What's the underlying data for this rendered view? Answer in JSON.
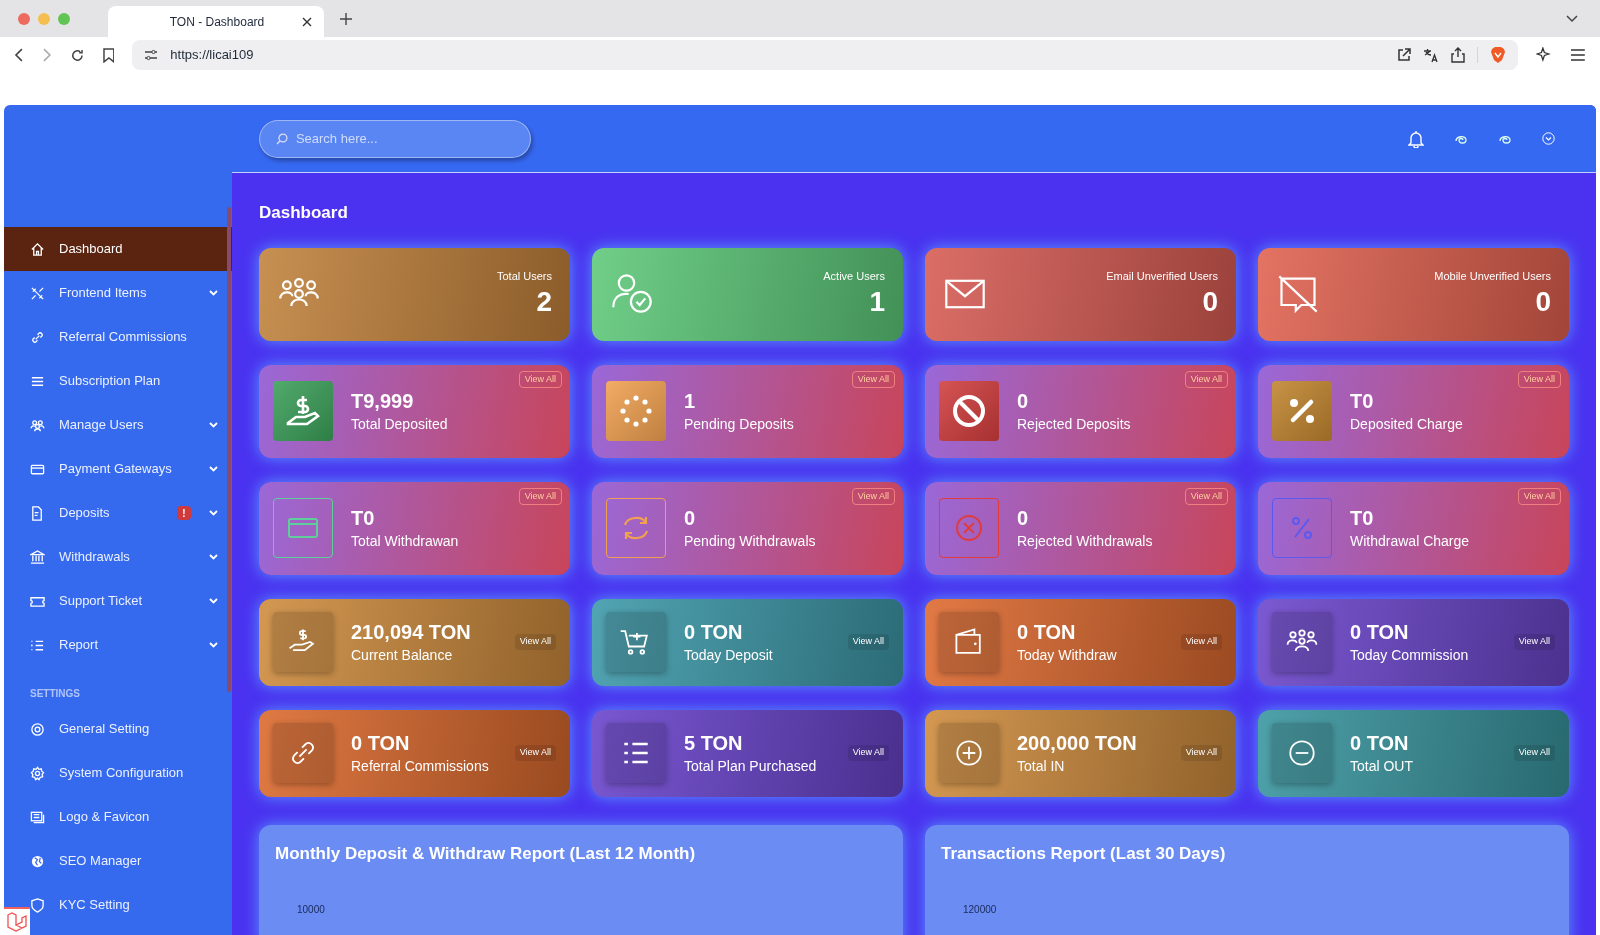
{
  "browser": {
    "tab_title": "TON - Dashboard",
    "url": "https://licai109"
  },
  "header": {
    "search": {
      "placeholder": "Search here..."
    }
  },
  "sidebar": {
    "items": [
      {
        "label": "Dashboard",
        "selected": true,
        "expandable": false
      },
      {
        "label": "Frontend Items",
        "selected": false,
        "expandable": true
      },
      {
        "label": "Referral Commissions",
        "selected": false,
        "expandable": false
      },
      {
        "label": "Subscription Plan",
        "selected": false,
        "expandable": false
      },
      {
        "label": "Manage Users",
        "selected": false,
        "expandable": true
      },
      {
        "label": "Payment Gateways",
        "selected": false,
        "expandable": true
      },
      {
        "label": "Deposits",
        "selected": false,
        "expandable": true,
        "badge": "!"
      },
      {
        "label": "Withdrawals",
        "selected": false,
        "expandable": true
      },
      {
        "label": "Support Ticket",
        "selected": false,
        "expandable": true
      },
      {
        "label": "Report",
        "selected": false,
        "expandable": true
      }
    ],
    "section_heading": "SETTINGS",
    "settings_items": [
      {
        "label": "General Setting",
        "selected": false
      },
      {
        "label": "System Configuration",
        "selected": false
      },
      {
        "label": "Logo & Favicon",
        "selected": false
      },
      {
        "label": "SEO Manager",
        "selected": false
      },
      {
        "label": "KYC Setting",
        "selected": false
      }
    ]
  },
  "page_title": "Dashboard",
  "cards": [
    {
      "kind": "stat",
      "label": "Total Users",
      "value": "2",
      "color": "#c0803a"
    },
    {
      "kind": "stat",
      "label": "Active Users",
      "value": "1",
      "color": "#5cc878"
    },
    {
      "kind": "stat",
      "label": "Email Unverified Users",
      "value": "0",
      "color": "#d65a52"
    },
    {
      "kind": "stat",
      "label": "Mobile Unverified Users",
      "value": "0",
      "color": "#e0604e"
    },
    {
      "kind": "widget",
      "value": "T9,999",
      "label": "Total Deposited",
      "link": "View All",
      "color": "#3a9e58"
    },
    {
      "kind": "widget",
      "value": "1",
      "label": "Pending Deposits",
      "link": "View All",
      "color": "#f0a050"
    },
    {
      "kind": "widget",
      "value": "0",
      "label": "Rejected Deposits",
      "link": "View All",
      "color": "#d03c3c"
    },
    {
      "kind": "widget",
      "value": "T0",
      "label": "Deposited Charge",
      "link": "View All",
      "color": "#c0842e"
    },
    {
      "kind": "outline",
      "value": "T0",
      "label": "Total Withdrawan",
      "link": "View All",
      "color": "#5ecf9a"
    },
    {
      "kind": "outline",
      "value": "0",
      "label": "Pending Withdrawals",
      "link": "View All",
      "color": "#f0a050"
    },
    {
      "kind": "outline",
      "value": "0",
      "label": "Rejected Withdrawals",
      "link": "View All",
      "color": "#e03c3c"
    },
    {
      "kind": "outline",
      "value": "T0",
      "label": "Withdrawal Charge",
      "link": "View All",
      "color": "#5a5af0"
    },
    {
      "kind": "balance",
      "value": "210,094 TON",
      "label": "Current Balance",
      "link": "View All",
      "color": "#cf8c3e"
    },
    {
      "kind": "balance",
      "value": "0 TON",
      "label": "Today Deposit",
      "link": "View All",
      "color": "#3e9aaa"
    },
    {
      "kind": "balance",
      "value": "0 TON",
      "label": "Today Withdraw",
      "link": "View All",
      "color": "#de6a30"
    },
    {
      "kind": "balance",
      "value": "0 TON",
      "label": "Today Commission",
      "link": "View All",
      "color": "#6c46cc"
    },
    {
      "kind": "balance",
      "value": "0 TON",
      "label": "Referral Commissions",
      "link": "View All",
      "color": "#dc6a2e"
    },
    {
      "kind": "balance",
      "value": "5 TON",
      "label": "Total Plan Purchased",
      "link": "View All",
      "color": "#6a44cc"
    },
    {
      "kind": "balance",
      "value": "200,000 TON",
      "label": "Total IN",
      "link": "View All",
      "color": "#cf8c3e"
    },
    {
      "kind": "balance",
      "value": "0 TON",
      "label": "Total OUT",
      "link": "View All",
      "color": "#3a96a0"
    }
  ],
  "panels": [
    {
      "title": "Monthly Deposit & Withdraw Report (Last 12 Month)",
      "top_tick": "10000"
    },
    {
      "title": "Transactions Report (Last 30 Days)",
      "top_tick": "120000"
    }
  ]
}
